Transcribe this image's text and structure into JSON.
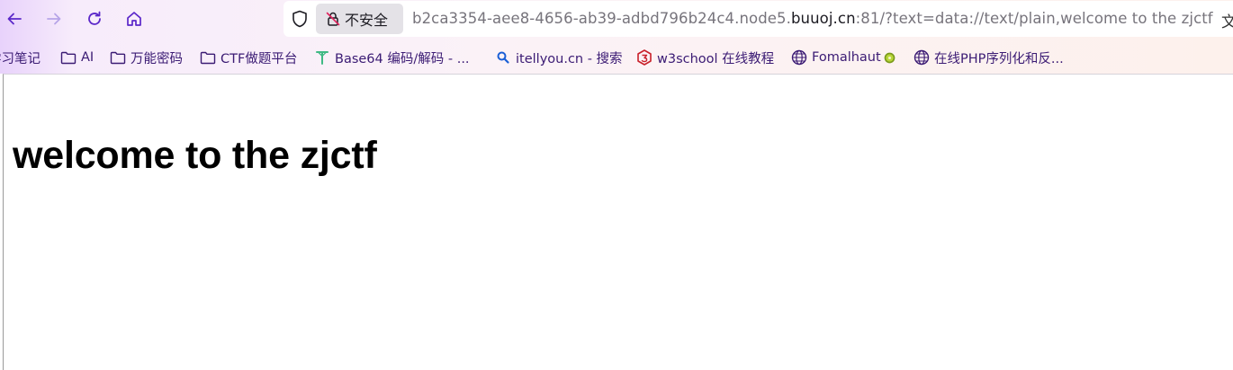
{
  "browser": {
    "security_label": "不安全",
    "url_prefix": "b2ca3354-aee8-4656-ab39-adbd796b24c4.node5.",
    "url_host": "buuoj.cn",
    "url_suffix": ":81/?text=data://text/plain,welcome to the zjctf",
    "translate_glyph": "文"
  },
  "bookmarks": [
    {
      "label": "学习笔记",
      "icon": "folder-icon"
    },
    {
      "label": "AI",
      "icon": "folder-icon"
    },
    {
      "label": "万能密码",
      "icon": "folder-icon"
    },
    {
      "label": "CTF做题平台",
      "icon": "folder-icon"
    },
    {
      "label": "Base64 编码/解码 - ...",
      "icon": "tool-icon"
    },
    {
      "label": "itellyou.cn - 搜索",
      "icon": "search-icon"
    },
    {
      "label": "w3school 在线教程",
      "icon": "w3school-icon"
    },
    {
      "label": "Fomalhaut",
      "icon": "globe-icon"
    },
    {
      "label": "在线PHP序列化和反...",
      "icon": "globe-icon"
    }
  ],
  "page": {
    "heading": "welcome to the zjctf"
  },
  "colors": {
    "nav_active": "#5b27c9",
    "nav_disabled": "#b7a4e8",
    "bookmark_text": "#3b1b74"
  }
}
